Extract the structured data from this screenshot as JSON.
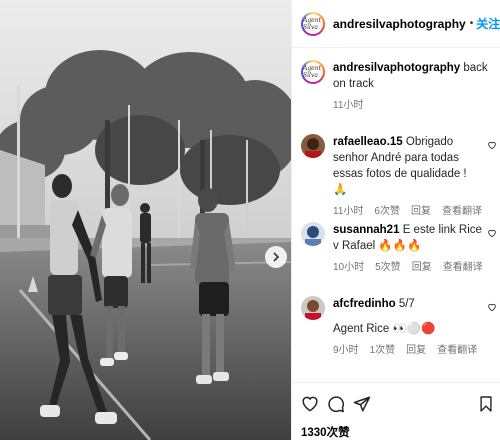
{
  "post": {
    "username": "andresilvaphotography",
    "follow_separator": "•",
    "follow_label": "关注",
    "more_label": "···",
    "avatar_text": "Agent Silva",
    "likes_label": "1330次赞"
  },
  "caption": {
    "username": "andresilvaphotography",
    "text": "back on track",
    "time": "11小时"
  },
  "comments": [
    {
      "username": "rafaelleao.15",
      "text": "Obrigado senhor André para todas essas fotos de qualidade ! 🙏",
      "time": "11小时",
      "likes": "6次赞",
      "reply": "回复",
      "translate": "查看翻译"
    },
    {
      "username": "susannah21",
      "text": "E este link Rice v Rafael 🔥🔥🔥",
      "time": "10小时",
      "likes": "5次赞",
      "reply": "回复",
      "translate": "查看翻译"
    },
    {
      "username": "afcfredinho",
      "text": "5/7",
      "text_line2": "Agent Rice 👀⚪🔴",
      "time": "9小时",
      "likes": "1次赞",
      "reply": "回复",
      "translate": "查看翻译"
    }
  ],
  "icons": {
    "like": "heart-icon",
    "comment": "comment-icon",
    "share": "share-icon",
    "save": "bookmark-icon",
    "next": "chevron-right-icon"
  },
  "colors": {
    "follow": "#0095f6",
    "secondary_text": "#737373"
  }
}
